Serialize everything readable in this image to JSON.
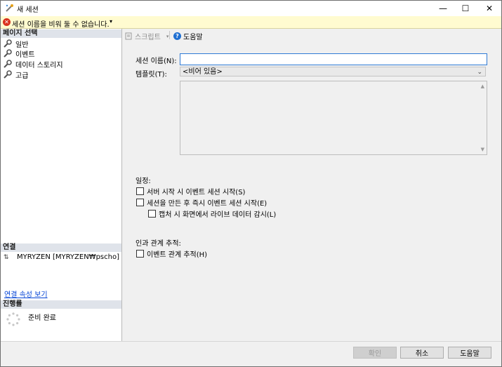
{
  "window": {
    "title": "새 세션",
    "minimize_glyph": "—",
    "maximize_glyph": "☐",
    "close_glyph": "✕"
  },
  "message_bar": {
    "text": "세션 이름을 비워 둘 수 없습니다.",
    "icon": "error-icon"
  },
  "left_pane": {
    "page_select_header": "페이지 선택",
    "nav_items": [
      {
        "label": "일반",
        "icon": "wrench-icon"
      },
      {
        "label": "이벤트",
        "icon": "wrench-icon"
      },
      {
        "label": "데이터 스토리지",
        "icon": "wrench-icon"
      },
      {
        "label": "고급",
        "icon": "wrench-icon"
      }
    ],
    "connection_header": "연결",
    "connection_text": "MYRYZEN [MYRYZEN₩pscho]",
    "connection_link": "연결 속성 보기",
    "progress_header": "진행률",
    "progress_status": "준비 완료"
  },
  "toolbar": {
    "script_label": "스크립트",
    "help_label": "도움말"
  },
  "form": {
    "session_name_label": "세션 이름(N):",
    "session_name_value": "",
    "template_label": "템플릿(T):",
    "template_value": "<비어 있음>",
    "schedule_label": "일정:",
    "chk_server_start": "서버 시작 시 이벤트 세션 시작(S)",
    "chk_start_after_create": "세션을 만든 후 즉시 이벤트 세션 시작(E)",
    "chk_watch_live": "캡처 시 화면에서 라이브 데이터 감시(L)",
    "causality_label": "인과 관계 추적:",
    "chk_track_causality": "이벤트 관계 추적(H)"
  },
  "buttons": {
    "ok": "확인",
    "cancel": "취소",
    "help": "도움말"
  }
}
